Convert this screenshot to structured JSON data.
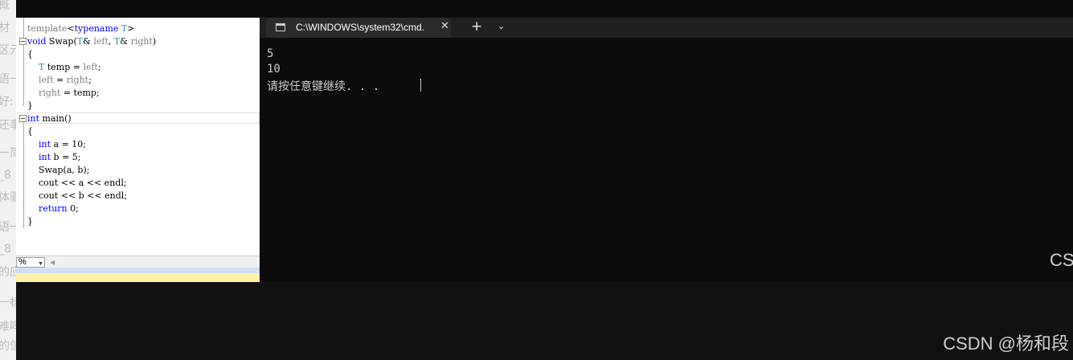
{
  "editor": {
    "lines": [
      {
        "fold": false,
        "segs": [
          {
            "t": "template",
            "c": "pm"
          },
          {
            "t": "<",
            "c": ""
          },
          {
            "t": "typename",
            "c": "kw"
          },
          {
            "t": " ",
            "c": ""
          },
          {
            "t": "T",
            "c": "ty"
          },
          {
            "t": ">",
            "c": ""
          }
        ]
      },
      {
        "fold": true,
        "segs": [
          {
            "t": "void",
            "c": "kw"
          },
          {
            "t": " Swap(",
            "c": ""
          },
          {
            "t": "T",
            "c": "ty"
          },
          {
            "t": "& ",
            "c": ""
          },
          {
            "t": "left",
            "c": "pm"
          },
          {
            "t": ", ",
            "c": ""
          },
          {
            "t": "T",
            "c": "ty"
          },
          {
            "t": "& ",
            "c": ""
          },
          {
            "t": "right",
            "c": "pm"
          },
          {
            "t": ")",
            "c": ""
          }
        ]
      },
      {
        "fold": false,
        "segs": [
          {
            "t": "{",
            "c": ""
          }
        ]
      },
      {
        "fold": false,
        "segs": [
          {
            "t": "    ",
            "c": ""
          },
          {
            "t": "T",
            "c": "ty"
          },
          {
            "t": " temp = ",
            "c": ""
          },
          {
            "t": "left",
            "c": "pm"
          },
          {
            "t": ";",
            "c": ""
          }
        ]
      },
      {
        "fold": false,
        "segs": [
          {
            "t": "    ",
            "c": ""
          },
          {
            "t": "left",
            "c": "pm"
          },
          {
            "t": " = ",
            "c": ""
          },
          {
            "t": "right",
            "c": "pm"
          },
          {
            "t": ";",
            "c": ""
          }
        ]
      },
      {
        "fold": false,
        "segs": [
          {
            "t": "    ",
            "c": ""
          },
          {
            "t": "right",
            "c": "pm"
          },
          {
            "t": " = temp;",
            "c": ""
          }
        ]
      },
      {
        "fold": false,
        "segs": [
          {
            "t": "}",
            "c": ""
          }
        ]
      },
      {
        "fold": true,
        "segs": [
          {
            "t": "int",
            "c": "kw"
          },
          {
            "t": " main()",
            "c": ""
          }
        ]
      },
      {
        "fold": false,
        "segs": [
          {
            "t": "{",
            "c": ""
          }
        ]
      },
      {
        "fold": false,
        "segs": [
          {
            "t": "    ",
            "c": ""
          },
          {
            "t": "int",
            "c": "kw"
          },
          {
            "t": " a = 10;",
            "c": ""
          }
        ]
      },
      {
        "fold": false,
        "segs": [
          {
            "t": "    ",
            "c": ""
          },
          {
            "t": "int",
            "c": "kw"
          },
          {
            "t": " b = 5;",
            "c": ""
          }
        ]
      },
      {
        "fold": false,
        "segs": [
          {
            "t": "    Swap(a, b);",
            "c": ""
          }
        ]
      },
      {
        "fold": false,
        "segs": [
          {
            "t": "    cout << a << endl;",
            "c": ""
          }
        ]
      },
      {
        "fold": false,
        "segs": [
          {
            "t": "    cout << b << endl;",
            "c": ""
          }
        ]
      },
      {
        "fold": false,
        "segs": [
          {
            "t": "    ",
            "c": ""
          },
          {
            "t": "return",
            "c": "kw"
          },
          {
            "t": " 0;",
            "c": ""
          }
        ]
      },
      {
        "fold": false,
        "segs": [
          {
            "t": "}",
            "c": ""
          }
        ]
      }
    ],
    "zoom_value": "%"
  },
  "terminal": {
    "tab_title": "C:\\WINDOWS\\system32\\cmd.",
    "tab_close": "✕",
    "new_tab": "+",
    "dropdown": "⌄",
    "output_lines": [
      "5",
      "10",
      "请按任意键继续. . . "
    ],
    "partial_overlay_text": "CS"
  },
  "watermark": "CSDN @杨和段",
  "background_fragments": [
    "概",
    "材",
    "区元",
    "语一",
    "好:",
    "还事",
    "一简",
    "_8",
    "体驱",
    "语一",
    "_8",
    "的应",
    "一标",
    "难吗",
    "的信"
  ]
}
